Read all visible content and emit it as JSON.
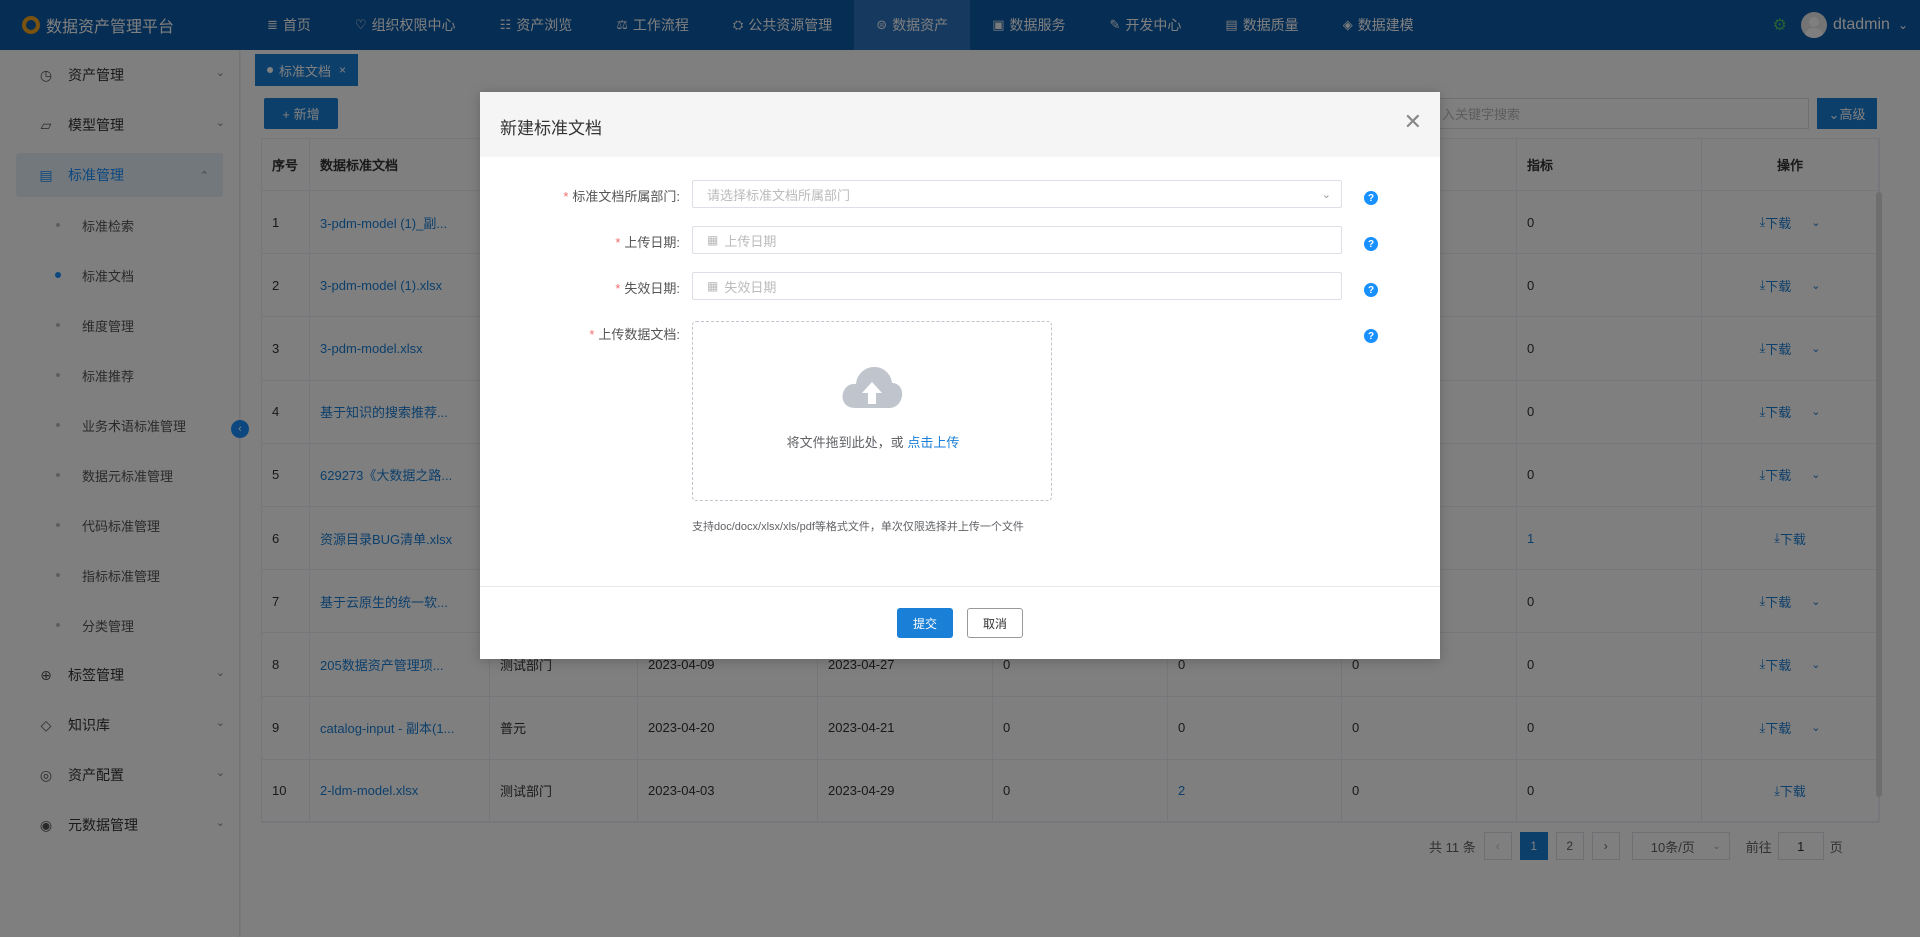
{
  "app": {
    "title": "数据资产管理平台"
  },
  "nav": [
    {
      "icon": "≣",
      "label": "首页"
    },
    {
      "icon": "♡",
      "label": "组织权限中心"
    },
    {
      "icon": "☷",
      "label": "资产浏览"
    },
    {
      "icon": "⚖",
      "label": "工作流程"
    },
    {
      "icon": "⛭",
      "label": "公共资源管理"
    },
    {
      "icon": "⊜",
      "label": "数据资产"
    },
    {
      "icon": "▣",
      "label": "数据服务"
    },
    {
      "icon": "✎",
      "label": "开发中心"
    },
    {
      "icon": "▤",
      "label": "数据质量"
    },
    {
      "icon": "◈",
      "label": "数据建模"
    }
  ],
  "user": {
    "name": "dtadmin"
  },
  "sidebar": {
    "groups": [
      {
        "icon": "◷",
        "label": "资产管理"
      },
      {
        "icon": "▱",
        "label": "模型管理"
      },
      {
        "icon": "▤",
        "label": "标准管理"
      }
    ],
    "sub": [
      "标准检索",
      "标准文档",
      "维度管理",
      "标准推荐",
      "业务术语标准管理",
      "数据元标准管理",
      "代码标准管理",
      "指标标准管理",
      "分类管理"
    ],
    "groups2": [
      {
        "icon": "⊕",
        "label": "标签管理"
      },
      {
        "icon": "◇",
        "label": "知识库"
      },
      {
        "icon": "◎",
        "label": "资产配置"
      },
      {
        "icon": "◉",
        "label": "元数据管理"
      }
    ]
  },
  "tab": {
    "label": "标准文档",
    "close": "×"
  },
  "toolbar": {
    "add_label": "+ 新增",
    "search_placeholder": "入关键字搜索",
    "advanced": "⌄高级"
  },
  "table": {
    "headers": {
      "index": "序号",
      "name": "数据标准文档",
      "metric": "指标",
      "action": "操作"
    },
    "rows": [
      {
        "index": "1",
        "name": "3-pdm-model (1)_副...",
        "dept": "",
        "d1": "",
        "d2": "",
        "c1": "",
        "c2": "",
        "c3": "",
        "metric": "0",
        "dl": "下载",
        "more": true
      },
      {
        "index": "2",
        "name": "3-pdm-model (1).xlsx",
        "dept": "",
        "d1": "",
        "d2": "",
        "c1": "",
        "c2": "",
        "c3": "",
        "metric": "0",
        "dl": "下载",
        "more": true
      },
      {
        "index": "3",
        "name": "3-pdm-model.xlsx",
        "dept": "",
        "d1": "",
        "d2": "",
        "c1": "",
        "c2": "",
        "c3": "",
        "metric": "0",
        "dl": "下载",
        "more": true
      },
      {
        "index": "4",
        "name": "基于知识的搜索推荐...",
        "dept": "",
        "d1": "",
        "d2": "",
        "c1": "",
        "c2": "",
        "c3": "",
        "metric": "0",
        "dl": "下载",
        "more": true
      },
      {
        "index": "5",
        "name": "629273《大数据之路...",
        "dept": "",
        "d1": "",
        "d2": "",
        "c1": "",
        "c2": "",
        "c3": "",
        "metric": "0",
        "dl": "下载",
        "more": true
      },
      {
        "index": "6",
        "name": "资源目录BUG清单.xlsx",
        "dept": "",
        "d1": "",
        "d2": "",
        "c1": "",
        "c2": "",
        "c3": "",
        "metric": "1",
        "dl": "下载",
        "more": false
      },
      {
        "index": "7",
        "name": "基于云原生的统一软...",
        "dept": "",
        "d1": "",
        "d2": "",
        "c1": "",
        "c2": "",
        "c3": "",
        "metric": "0",
        "dl": "下载",
        "more": true
      },
      {
        "index": "8",
        "name": "205数据资产管理项...",
        "dept": "测试部门",
        "d1": "2023-04-09",
        "d2": "2023-04-27",
        "c1": "0",
        "c2": "0",
        "c3": "0",
        "metric": "0",
        "dl": "下载",
        "more": true
      },
      {
        "index": "9",
        "name": "catalog-input - 副本(1...",
        "dept": "普元",
        "d1": "2023-04-20",
        "d2": "2023-04-21",
        "c1": "0",
        "c2": "0",
        "c3": "0",
        "metric": "0",
        "dl": "下载",
        "more": true
      },
      {
        "index": "10",
        "name": "2-ldm-model.xlsx",
        "dept": "测试部门",
        "d1": "2023-04-03",
        "d2": "2023-04-29",
        "c1": "0",
        "c2": "2",
        "c3": "0",
        "metric": "0",
        "dl": "下载",
        "more": false
      }
    ]
  },
  "pager": {
    "total": "共 11 条",
    "pages": [
      "1",
      "2"
    ],
    "size": "10条/页",
    "goto_prefix": "前往",
    "goto_value": "1",
    "goto_suffix": "页"
  },
  "modal": {
    "title": "新建标准文档",
    "fields": {
      "dept_label": "标准文档所属部门:",
      "dept_placeholder": "请选择标准文档所属部门",
      "upload_date_label": "上传日期:",
      "upload_date_placeholder": "上传日期",
      "expire_date_label": "失效日期:",
      "expire_date_placeholder": "失效日期",
      "file_label": "上传数据文档:"
    },
    "upload_text": "将文件拖到此处，或",
    "upload_link": "点击上传",
    "upload_hint": "支持doc/docx/xlsx/xls/pdf等格式文件，单次仅限选择并上传一个文件",
    "submit": "提交",
    "cancel": "取消"
  }
}
